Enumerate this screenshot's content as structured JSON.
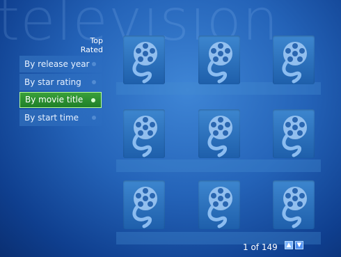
{
  "watermark": "television",
  "section_label": "Top Rated",
  "menu": [
    {
      "label": "By release year",
      "selected": false
    },
    {
      "label": "By star rating",
      "selected": false
    },
    {
      "label": "By movie title",
      "selected": true
    },
    {
      "label": "By start time",
      "selected": false
    }
  ],
  "grid_icon": "film-reel-icon",
  "pager": {
    "text": "1 of 149",
    "up_icon": "chevron-up-icon",
    "down_icon": "chevron-down-icon"
  },
  "colors": {
    "selected": "#2a8f2d",
    "selected_border": "#b9ff9a",
    "background": "#2463b8"
  }
}
